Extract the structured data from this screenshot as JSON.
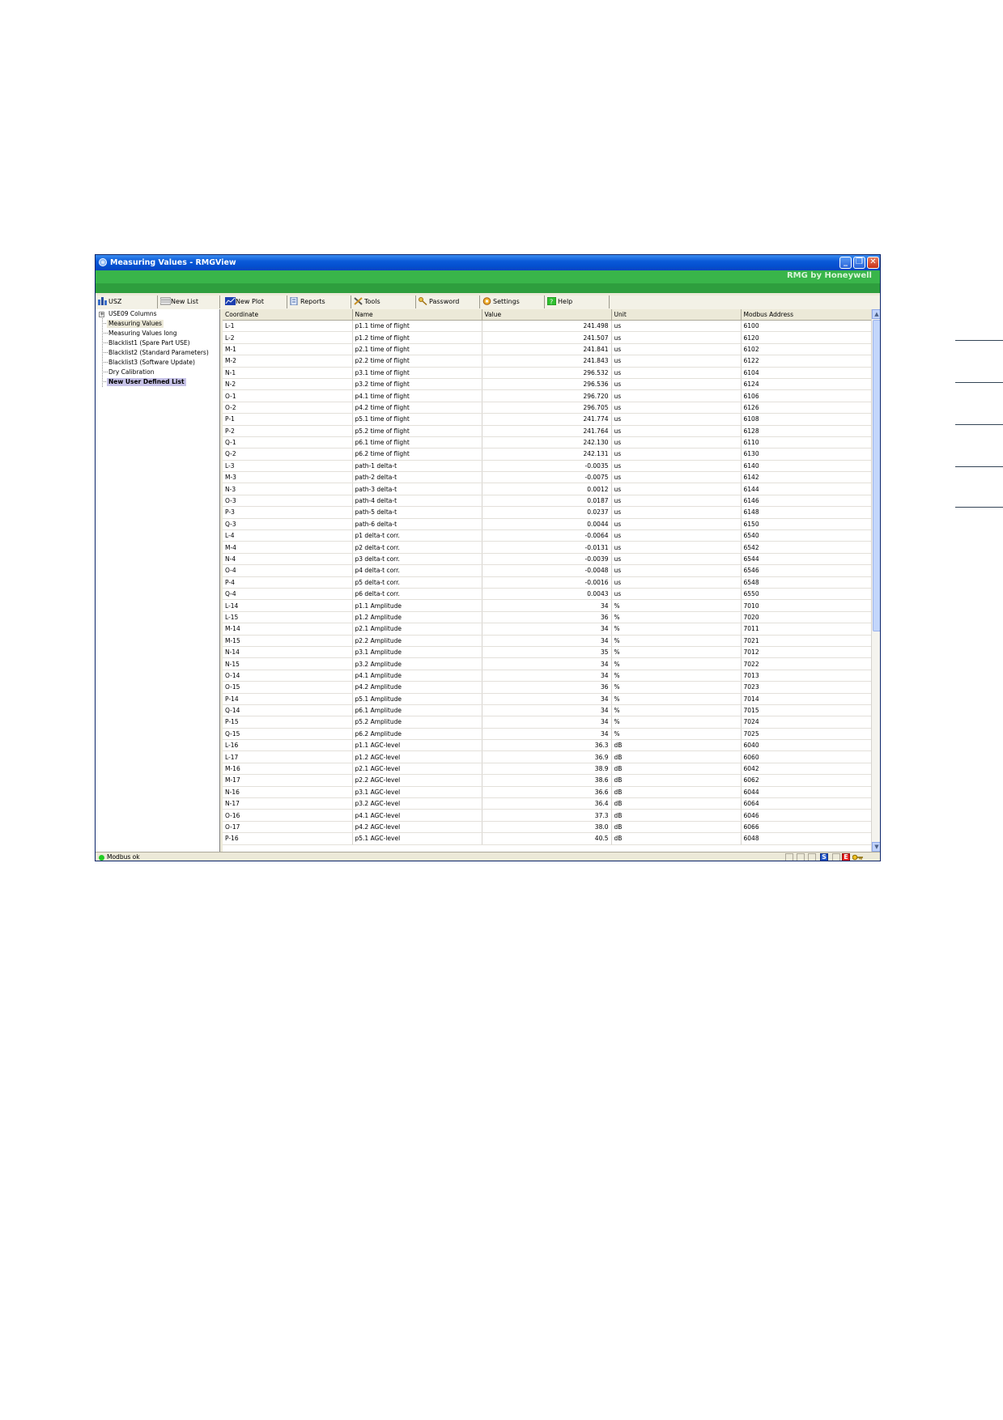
{
  "window": {
    "title": "Measuring Values - RMGView",
    "brand": "RMG by Honeywell"
  },
  "toolbar": {
    "usz": "USZ",
    "new_list": "New List",
    "new_plot": "New Plot",
    "reports": "Reports",
    "tools": "Tools",
    "password": "Password",
    "settings": "Settings",
    "help": "Help"
  },
  "sidebar": {
    "items": [
      {
        "label": "USE09 Columns"
      },
      {
        "label": "Measuring Values"
      },
      {
        "label": "Measuring Values long"
      },
      {
        "label": "Blacklist1 (Spare Part USE)"
      },
      {
        "label": "Blacklist2 (Standard Parameters)"
      },
      {
        "label": "Blacklist3 (Software Update)"
      },
      {
        "label": "Dry Calibration"
      },
      {
        "label": "New User Defined List"
      }
    ]
  },
  "table": {
    "columns": [
      "Coordinate",
      "Name",
      "Value",
      "Unit",
      "Modbus Address"
    ],
    "rows": [
      [
        "L-1",
        "p1.1 time of flight",
        "241.498",
        "us",
        "6100"
      ],
      [
        "L-2",
        "p1.2 time of flight",
        "241.507",
        "us",
        "6120"
      ],
      [
        "M-1",
        "p2.1 time of flight",
        "241.841",
        "us",
        "6102"
      ],
      [
        "M-2",
        "p2.2 time of flight",
        "241.843",
        "us",
        "6122"
      ],
      [
        "N-1",
        "p3.1 time of flight",
        "296.532",
        "us",
        "6104"
      ],
      [
        "N-2",
        "p3.2 time of flight",
        "296.536",
        "us",
        "6124"
      ],
      [
        "O-1",
        "p4.1 time of flight",
        "296.720",
        "us",
        "6106"
      ],
      [
        "O-2",
        "p4.2 time of flight",
        "296.705",
        "us",
        "6126"
      ],
      [
        "P-1",
        "p5.1 time of flight",
        "241.774",
        "us",
        "6108"
      ],
      [
        "P-2",
        "p5.2 time of flight",
        "241.764",
        "us",
        "6128"
      ],
      [
        "Q-1",
        "p6.1 time of flight",
        "242.130",
        "us",
        "6110"
      ],
      [
        "Q-2",
        "p6.2 time of flight",
        "242.131",
        "us",
        "6130"
      ],
      [
        "L-3",
        "path-1 delta-t",
        "-0.0035",
        "us",
        "6140"
      ],
      [
        "M-3",
        "path-2 delta-t",
        "-0.0075",
        "us",
        "6142"
      ],
      [
        "N-3",
        "path-3 delta-t",
        "0.0012",
        "us",
        "6144"
      ],
      [
        "O-3",
        "path-4 delta-t",
        "0.0187",
        "us",
        "6146"
      ],
      [
        "P-3",
        "path-5 delta-t",
        "0.0237",
        "us",
        "6148"
      ],
      [
        "Q-3",
        "path-6 delta-t",
        "0.0044",
        "us",
        "6150"
      ],
      [
        "L-4",
        "p1 delta-t corr.",
        "-0.0064",
        "us",
        "6540"
      ],
      [
        "M-4",
        "p2 delta-t corr.",
        "-0.0131",
        "us",
        "6542"
      ],
      [
        "N-4",
        "p3 delta-t corr.",
        "-0.0039",
        "us",
        "6544"
      ],
      [
        "O-4",
        "p4 delta-t corr.",
        "-0.0048",
        "us",
        "6546"
      ],
      [
        "P-4",
        "p5 delta-t corr.",
        "-0.0016",
        "us",
        "6548"
      ],
      [
        "Q-4",
        "p6 delta-t corr.",
        "0.0043",
        "us",
        "6550"
      ],
      [
        "L-14",
        "p1.1 Amplitude",
        "34",
        "%",
        "7010"
      ],
      [
        "L-15",
        "p1.2 Amplitude",
        "36",
        "%",
        "7020"
      ],
      [
        "M-14",
        "p2.1 Amplitude",
        "34",
        "%",
        "7011"
      ],
      [
        "M-15",
        "p2.2 Amplitude",
        "34",
        "%",
        "7021"
      ],
      [
        "N-14",
        "p3.1 Amplitude",
        "35",
        "%",
        "7012"
      ],
      [
        "N-15",
        "p3.2 Amplitude",
        "34",
        "%",
        "7022"
      ],
      [
        "O-14",
        "p4.1 Amplitude",
        "34",
        "%",
        "7013"
      ],
      [
        "O-15",
        "p4.2 Amplitude",
        "36",
        "%",
        "7023"
      ],
      [
        "P-14",
        "p5.1 Amplitude",
        "34",
        "%",
        "7014"
      ],
      [
        "Q-14",
        "p6.1 Amplitude",
        "34",
        "%",
        "7015"
      ],
      [
        "P-15",
        "p5.2 Amplitude",
        "34",
        "%",
        "7024"
      ],
      [
        "Q-15",
        "p6.2 Amplitude",
        "34",
        "%",
        "7025"
      ],
      [
        "L-16",
        "p1.1 AGC-level",
        "36.3",
        "dB",
        "6040"
      ],
      [
        "L-17",
        "p1.2 AGC-level",
        "36.9",
        "dB",
        "6060"
      ],
      [
        "M-16",
        "p2.1 AGC-level",
        "38.9",
        "dB",
        "6042"
      ],
      [
        "M-17",
        "p2.2 AGC-level",
        "38.6",
        "dB",
        "6062"
      ],
      [
        "N-16",
        "p3.1 AGC-level",
        "36.6",
        "dB",
        "6044"
      ],
      [
        "N-17",
        "p3.2 AGC-level",
        "36.4",
        "dB",
        "6064"
      ],
      [
        "O-16",
        "p4.1 AGC-level",
        "37.3",
        "dB",
        "6046"
      ],
      [
        "O-17",
        "p4.2 AGC-level",
        "38.0",
        "dB",
        "6066"
      ],
      [
        "P-16",
        "p5.1 AGC-level",
        "40.5",
        "dB",
        "6048"
      ]
    ]
  },
  "status": {
    "text": "Modbus ok",
    "indicator_s": "S",
    "indicator_e": "E"
  },
  "colors": {
    "titlebar": "#0a5ad8",
    "brandbar": "#39b54a",
    "status_ok": "#22cc22"
  }
}
